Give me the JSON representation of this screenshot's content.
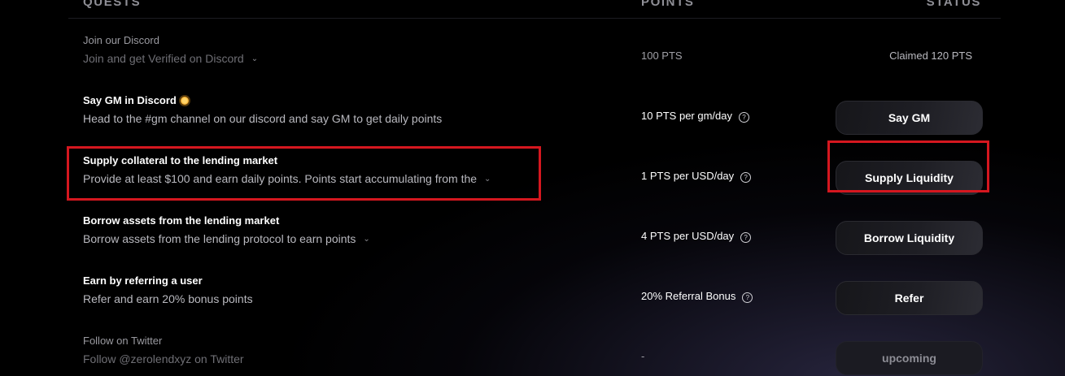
{
  "header": {
    "quests": "QUESTS",
    "points": "POINTS",
    "status": "STATUS"
  },
  "quests": [
    {
      "title": "Join our Discord",
      "description": "Join and get Verified on Discord",
      "points": "100 PTS",
      "status_text": "Claimed 120 PTS"
    },
    {
      "title": "Say GM in Discord",
      "description": "Head to the #gm channel on our discord and say GM to get daily points",
      "points": "10 PTS per gm/day",
      "button": "Say GM"
    },
    {
      "title": "Supply collateral to the lending market",
      "description": "Provide at least $100 and earn daily points. Points start accumulating from the",
      "points": "1 PTS per USD/day",
      "button": "Supply Liquidity"
    },
    {
      "title": "Borrow assets from the lending market",
      "description": "Borrow assets from the lending protocol to earn points",
      "points": "4 PTS per USD/day",
      "button": "Borrow Liquidity"
    },
    {
      "title": "Earn by referring a user",
      "description": "Refer and earn 20% bonus points",
      "points": "20% Referral Bonus",
      "button": "Refer"
    },
    {
      "title": "Follow on Twitter",
      "description": "Follow @zerolendxyz on Twitter",
      "points": "-",
      "button": "upcoming"
    }
  ],
  "icons": {
    "info": "info-circle-icon",
    "chevron": "chevron-down-icon",
    "sun": "sun-emoji-icon"
  },
  "colors": {
    "highlight": "#d5171f",
    "background": "#000000"
  }
}
